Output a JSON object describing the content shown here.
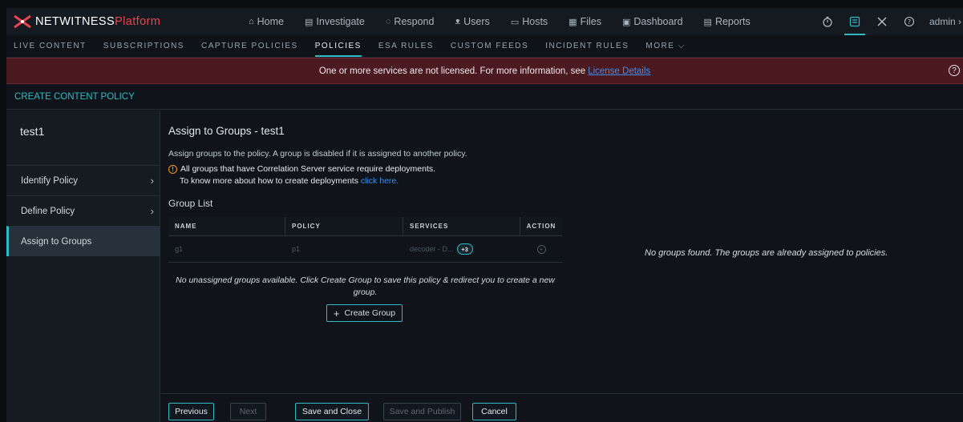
{
  "app": {
    "brand_primary": "NETWITNESS",
    "brand_secondary": "Platform",
    "brand_color": "#e8454f",
    "accent_color": "#31b9c4"
  },
  "nav": {
    "items": [
      {
        "label": "Home",
        "icon": "home-icon",
        "glyph": "⌂"
      },
      {
        "label": "Investigate",
        "icon": "investigate-icon",
        "glyph": "▤"
      },
      {
        "label": "Respond",
        "icon": "respond-icon",
        "glyph": "◌"
      },
      {
        "label": "Users",
        "icon": "users-icon",
        "glyph": "ᴥ"
      },
      {
        "label": "Hosts",
        "icon": "hosts-icon",
        "glyph": "▭"
      },
      {
        "label": "Files",
        "icon": "files-icon",
        "glyph": "▦"
      },
      {
        "label": "Dashboard",
        "icon": "dashboard-icon",
        "glyph": "▣"
      },
      {
        "label": "Reports",
        "icon": "reports-icon",
        "glyph": "▤"
      }
    ],
    "admin_label": "admin"
  },
  "subnav": {
    "items": [
      "LIVE CONTENT",
      "SUBSCRIPTIONS",
      "CAPTURE POLICIES",
      "POLICIES",
      "ESA RULES",
      "CUSTOM FEEDS",
      "INCIDENT RULES",
      "MORE"
    ],
    "active": "POLICIES"
  },
  "banner": {
    "text": "One or more services are not licensed. For more information, see",
    "link": "License Details"
  },
  "page": {
    "title": "CREATE CONTENT POLICY"
  },
  "sidebar": {
    "policy_name": "test1",
    "steps": [
      {
        "label": "Identify Policy"
      },
      {
        "label": "Define Policy"
      },
      {
        "label": "Assign to Groups"
      }
    ]
  },
  "main": {
    "title": "Assign to Groups - test1",
    "description": "Assign groups to the policy. A group is disabled if it is assigned to another policy.",
    "warning_line1": "All groups that have Correlation Server service require deployments.",
    "warning_line2": "To know more about how to create deployments",
    "warning_link": "click here.",
    "group_list_label": "Group List",
    "table": {
      "headers": [
        "NAME",
        "POLICY",
        "SERVICES",
        "ACTION"
      ],
      "row": {
        "name": "g1",
        "policy": "p1",
        "services": "decoder - D...",
        "services_more": "+3"
      }
    },
    "no_unassigned_text": "No unassigned groups available. Click Create Group to save this policy & redirect you to create a new group.",
    "create_group_label": "Create Group",
    "no_groups_text": "No groups found. The groups are already assigned to policies."
  },
  "footer": {
    "previous": "Previous",
    "next": "Next",
    "save_close": "Save and Close",
    "save_publish": "Save and Publish",
    "cancel": "Cancel"
  }
}
